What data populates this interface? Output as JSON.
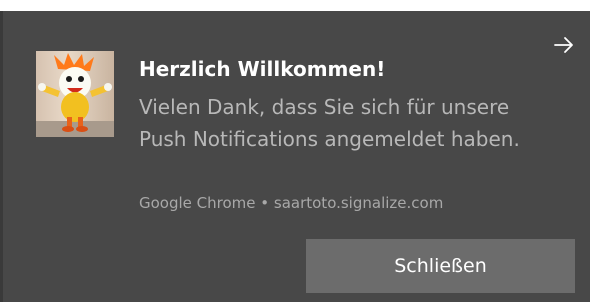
{
  "notification": {
    "title": "Herzlich Willkommen!",
    "message": "Vielen Dank, dass Sie sich für unsere Push Notifications angemeldet haben.",
    "source": "Google Chrome • saartoto.signalize.com",
    "close_label": "Schließen",
    "expand_icon": "arrow-right-icon",
    "image": "mascot-image"
  },
  "colors": {
    "background": "#484848",
    "title": "#ffffff",
    "message": "#b8b8b8",
    "button": "#6c6c6c"
  }
}
